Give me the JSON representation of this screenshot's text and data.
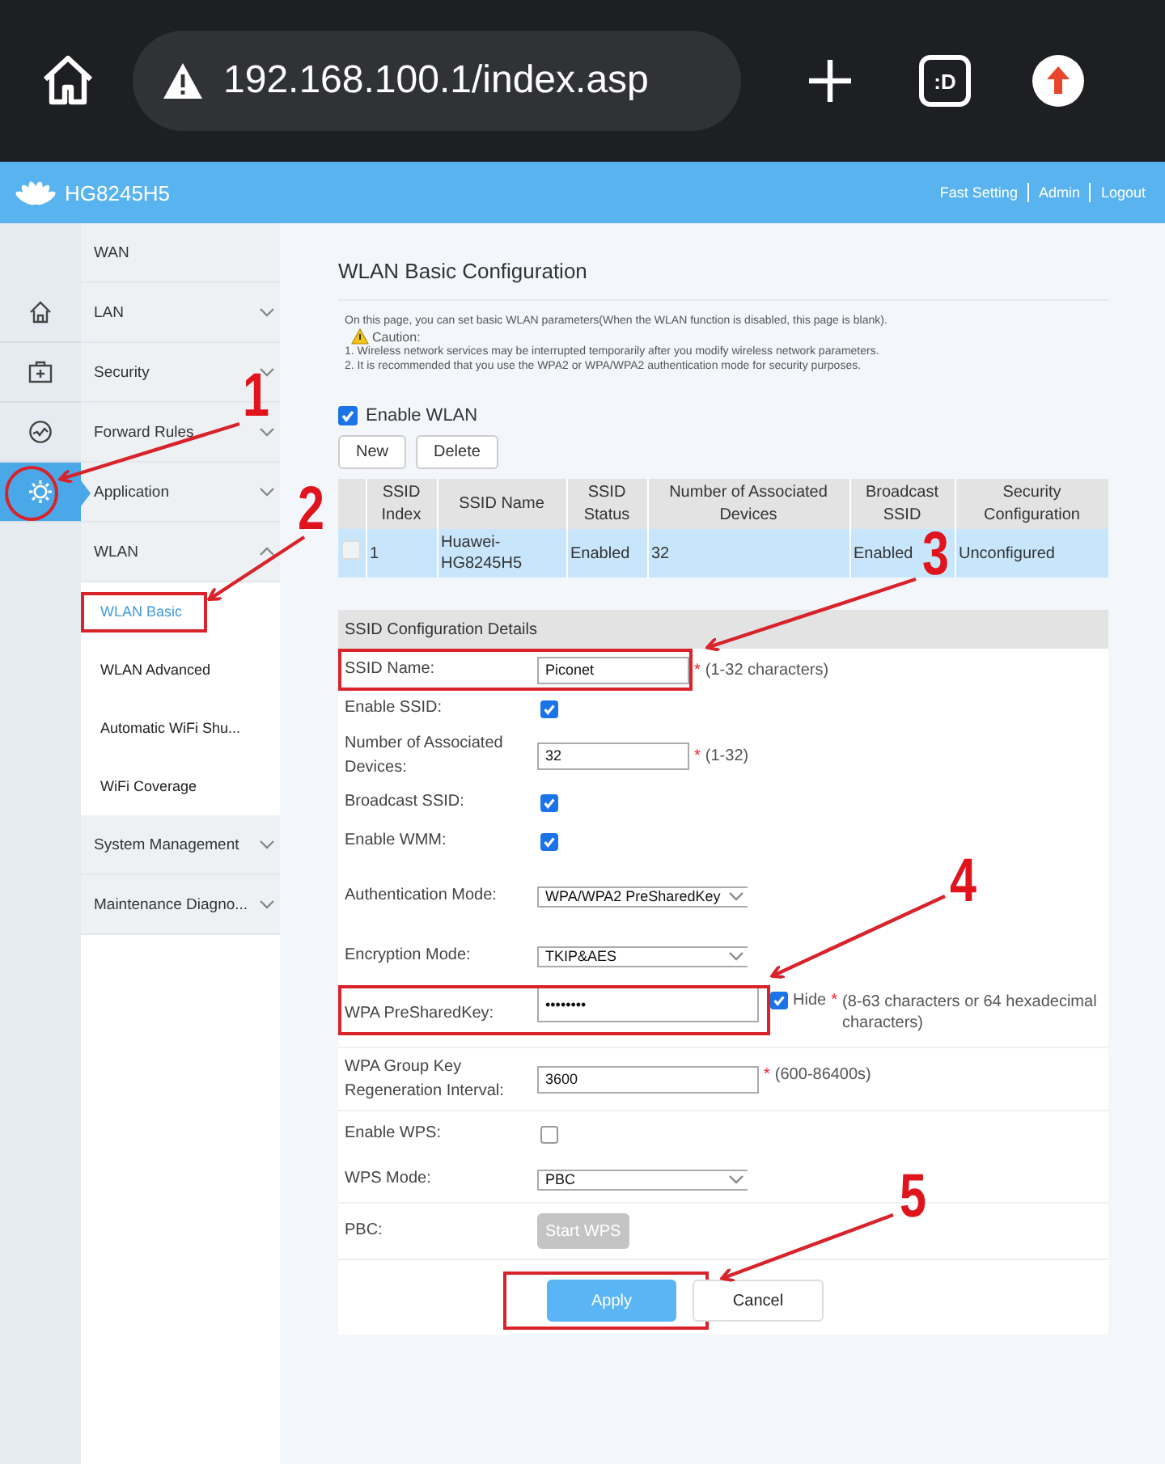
{
  "browser": {
    "url": "192.168.100.1/index.asp",
    "tab_count": ":D"
  },
  "header": {
    "model": "HG8245H5",
    "links": [
      "Fast Setting",
      "Admin",
      "Logout"
    ]
  },
  "rail": [
    {
      "kind": "home",
      "selected": false
    },
    {
      "kind": "toolbox",
      "selected": false
    },
    {
      "kind": "gauge",
      "selected": false
    },
    {
      "kind": "gear",
      "selected": true
    }
  ],
  "nav": [
    {
      "label": "WAN",
      "kind": "plain"
    },
    {
      "label": "LAN",
      "kind": "group",
      "expanded": false
    },
    {
      "label": "Security",
      "kind": "group",
      "expanded": false
    },
    {
      "label": "Forward Rules",
      "kind": "group",
      "expanded": false
    },
    {
      "label": "Application",
      "kind": "group",
      "expanded": false
    },
    {
      "label": "WLAN",
      "kind": "group",
      "expanded": true,
      "children": [
        {
          "label": "WLAN Basic",
          "selected": true
        },
        {
          "label": "WLAN Advanced",
          "selected": false
        },
        {
          "label": "Automatic WiFi Shu...",
          "selected": false
        },
        {
          "label": "WiFi Coverage",
          "selected": false
        }
      ]
    },
    {
      "label": "System Management",
      "kind": "group",
      "expanded": false
    },
    {
      "label": "Maintenance Diagno...",
      "kind": "group",
      "expanded": false
    }
  ],
  "content": {
    "title": "WLAN Basic Configuration",
    "intro": "On this page, you can set basic WLAN parameters(When the WLAN function is disabled, this page is blank).",
    "caution": "Caution:",
    "notes": [
      "1. Wireless network services may be interrupted temporarily after you modify wireless network parameters.",
      "2. It is recommended that you use the WPA2 or WPA/WPA2 authentication mode for security purposes."
    ],
    "enable_wlan": {
      "label": "Enable WLAN",
      "checked": true
    },
    "buttons": [
      "New",
      "Delete"
    ],
    "table": {
      "columns": [
        "SSID Index",
        "SSID Name",
        "SSID Status",
        "Number of Associated Devices",
        "Broadcast SSID",
        "Security Configuration"
      ],
      "rows": [
        {
          "checked": false,
          "selected": true,
          "cells": [
            "1",
            "Huawei-HG8245H5",
            "Enabled",
            "32",
            "Enabled",
            "Unconfigured"
          ]
        }
      ]
    },
    "details": {
      "title": "SSID Configuration Details",
      "fields": [
        {
          "kind": "text",
          "label": "SSID Name:",
          "value": "Piconet",
          "mark": "*",
          "hint": "(1-32 characters)"
        },
        {
          "kind": "checkbox",
          "label": "Enable SSID:",
          "checked": true
        },
        {
          "kind": "text",
          "label": "Number of Associated Devices:",
          "value": "32",
          "mark": "*",
          "hint": "(1-32)"
        },
        {
          "kind": "checkbox",
          "label": "Broadcast SSID:",
          "checked": true
        },
        {
          "kind": "checkbox",
          "label": "Enable WMM:",
          "checked": true
        },
        {
          "kind": "select",
          "label": "Authentication Mode:",
          "value": "WPA/WPA2 PreSharedKey"
        },
        {
          "kind": "select",
          "label": "Encryption Mode:",
          "value": "TKIP&AES"
        },
        {
          "kind": "password",
          "label": "WPA PreSharedKey:",
          "value": "••••••••",
          "hide_label": "Hide",
          "hide_checked": true,
          "mark": "*",
          "hint": "(8-63 characters or 64 hexadecimal characters)"
        },
        {
          "kind": "text",
          "label": "WPA Group Key Regeneration Interval:",
          "value": "3600",
          "mark": "*",
          "hint": "(600-86400s)"
        },
        {
          "kind": "checkbox",
          "label": "Enable WPS:",
          "checked": false
        },
        {
          "kind": "select",
          "label": "WPS Mode:",
          "value": "PBC"
        },
        {
          "kind": "button",
          "label": "PBC:",
          "button": "Start WPS",
          "disabled": true
        }
      ]
    },
    "actions": [
      {
        "label": "Apply",
        "primary": true
      },
      {
        "label": "Cancel",
        "primary": false
      }
    ]
  },
  "annotations": [
    {
      "label": "1"
    },
    {
      "label": "2"
    },
    {
      "label": "3"
    },
    {
      "label": "4"
    },
    {
      "label": "5"
    }
  ]
}
